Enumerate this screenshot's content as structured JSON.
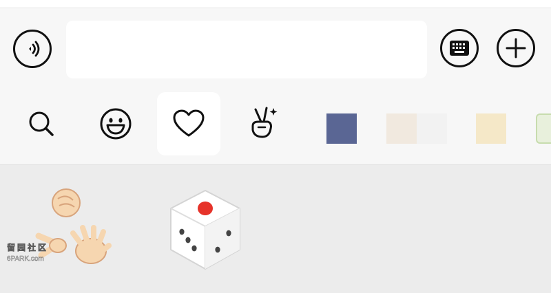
{
  "colors": {
    "icon_stroke": "#111111",
    "dice_pip": "#e6332a",
    "swatch_1": "#5a6694",
    "swatch_2a": "#f1e9df",
    "swatch_2b": "#f2f2f2",
    "swatch_3": "#f5e8c8",
    "swatch_4": "#e8f0dc"
  },
  "input_bar": {
    "voice_icon": "voice-wave-icon",
    "text_value": "",
    "keyboard_icon": "keyboard-icon",
    "add_icon": "plus-icon"
  },
  "sticker_tabs": [
    {
      "icon": "search-icon",
      "active": false
    },
    {
      "icon": "smile-face-icon",
      "active": false
    },
    {
      "icon": "heart-icon",
      "active": true
    },
    {
      "icon": "victory-hand-icon",
      "active": false
    },
    {
      "icon": "sticker-pack-1",
      "active": false
    },
    {
      "icon": "sticker-pack-2",
      "active": false
    },
    {
      "icon": "sticker-pack-3",
      "active": false
    },
    {
      "icon": "sticker-pack-4",
      "active": false
    }
  ],
  "stickers": [
    {
      "name": "rock-paper-scissors-sticker"
    },
    {
      "name": "dice-sticker"
    }
  ],
  "watermark": {
    "line1": "留园社区",
    "line2": "6PARK.com"
  }
}
